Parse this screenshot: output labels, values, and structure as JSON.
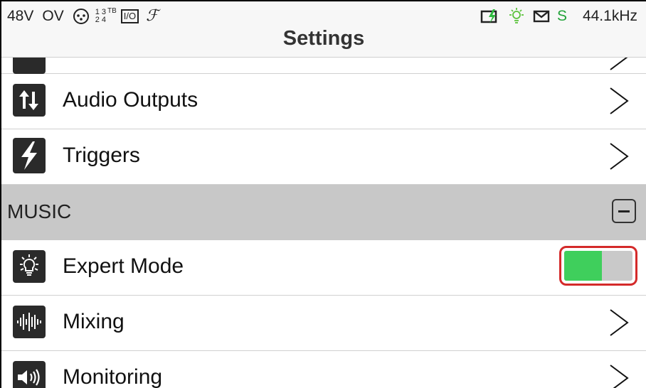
{
  "status": {
    "phantom": "48V",
    "overload": "OV",
    "inputs_top": "1 3",
    "inputs_bottom": "2 4",
    "inputs_suffix": "TB",
    "io_label": "I/O",
    "fx_glyph": "ℱ",
    "s_label": "S",
    "sample_rate": "44.1kHz",
    "accent_green": "#23a33a"
  },
  "header": {
    "title": "Settings"
  },
  "rows": [
    {
      "label": "Audio Outputs",
      "icon": "up-down-arrows-icon"
    },
    {
      "label": "Triggers",
      "icon": "lightning-icon"
    }
  ],
  "section": {
    "label": "MUSIC"
  },
  "music_rows": [
    {
      "label": "Expert Mode",
      "icon": "lightbulb-icon",
      "toggle_value": 0.55,
      "toggle_on_color": "#3fcf5c"
    },
    {
      "label": "Mixing",
      "icon": "waveform-icon"
    },
    {
      "label": "Monitoring",
      "icon": "speaker-icon"
    }
  ]
}
